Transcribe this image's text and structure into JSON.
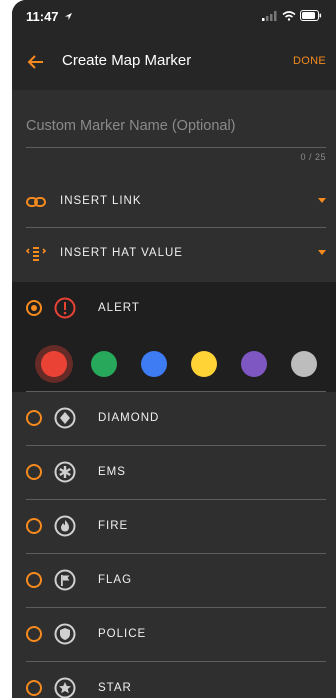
{
  "status": {
    "time": "11:47"
  },
  "appbar": {
    "title": "Create Map Marker",
    "done_label": "DONE"
  },
  "name_field": {
    "placeholder": "Custom Marker Name (Optional)",
    "counter": "0 / 25"
  },
  "dropdowns": {
    "insert_link": "INSERT LINK",
    "insert_hat_value": "INSERT HAT VALUE"
  },
  "colors": {
    "accent": "#f58a1f",
    "swatches": [
      "#ea4335",
      "#27a85a",
      "#3d7cf2",
      "#ffd236",
      "#7e57c2",
      "#bdbdbd"
    ],
    "selected_swatch": 0
  },
  "markers": [
    {
      "label": "ALERT",
      "icon": "alert-icon",
      "selected": true
    },
    {
      "label": "DIAMOND",
      "icon": "diamond-icon",
      "selected": false
    },
    {
      "label": "EMS",
      "icon": "ems-icon",
      "selected": false
    },
    {
      "label": "FIRE",
      "icon": "fire-icon",
      "selected": false
    },
    {
      "label": "FLAG",
      "icon": "flag-icon",
      "selected": false
    },
    {
      "label": "POLICE",
      "icon": "police-icon",
      "selected": false
    },
    {
      "label": "STAR",
      "icon": "star-icon",
      "selected": false
    }
  ]
}
